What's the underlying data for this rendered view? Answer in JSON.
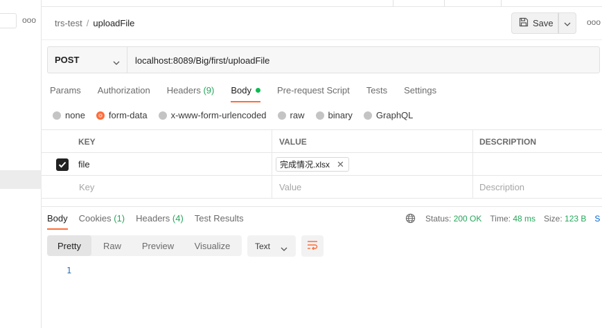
{
  "sidebar": {
    "more_label": "ooo"
  },
  "header": {
    "collection": "trs-test",
    "separator": "/",
    "request_name": "uploadFile",
    "save_label": "Save",
    "more_label": "ooo"
  },
  "request": {
    "method": "POST",
    "url": "localhost:8089/Big/first/uploadFile"
  },
  "request_tabs": [
    {
      "label": "Params"
    },
    {
      "label": "Authorization"
    },
    {
      "label": "Headers",
      "count": "(9)"
    },
    {
      "label": "Body",
      "active": true
    },
    {
      "label": "Pre-request Script"
    },
    {
      "label": "Tests"
    },
    {
      "label": "Settings"
    }
  ],
  "body_types": [
    "none",
    "form-data",
    "x-www-form-urlencoded",
    "raw",
    "binary",
    "GraphQL"
  ],
  "body_type_selected": "form-data",
  "params_table": {
    "headers": [
      "KEY",
      "VALUE",
      "DESCRIPTION"
    ],
    "rows": [
      {
        "checked": true,
        "key": "file",
        "value": "完成情况.xlsx",
        "description": ""
      }
    ],
    "placeholder": {
      "key": "Key",
      "value": "Value",
      "description": "Description"
    }
  },
  "response_tabs": [
    {
      "label": "Body",
      "active": true
    },
    {
      "label": "Cookies",
      "count": "(1)"
    },
    {
      "label": "Headers",
      "count": "(4)"
    },
    {
      "label": "Test Results"
    }
  ],
  "response_status": {
    "status_label": "Status:",
    "status_value": "200 OK",
    "time_label": "Time:",
    "time_value": "48 ms",
    "size_label": "Size:",
    "size_value": "123 B",
    "cut_text": "S"
  },
  "view_modes": [
    "Pretty",
    "Raw",
    "Preview",
    "Visualize"
  ],
  "view_mode_selected": "Pretty",
  "format_label": "Text",
  "response_line_number": "1",
  "colors": {
    "accent": "#ff6c37",
    "success": "#26a65b",
    "dot": "#0cbb52"
  }
}
